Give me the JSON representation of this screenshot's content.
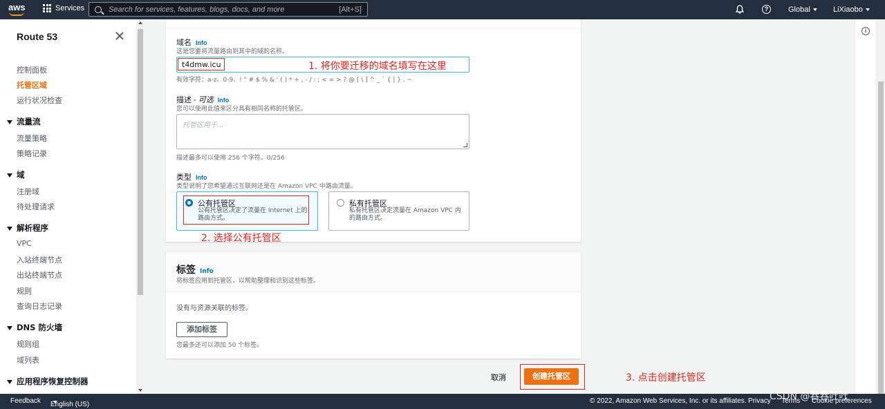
{
  "topnav": {
    "logo": "aws",
    "services": "Services",
    "search_placeholder": "Search for services, features, blogs, docs, and more",
    "search_shortcut": "[Alt+S]",
    "region": "Global",
    "user": "LiXiaobo"
  },
  "sidebar": {
    "title": "Route 53",
    "items_top": [
      "控制面板",
      "托管区域",
      "运行状况检查"
    ],
    "active_item": "托管区域",
    "groups": [
      {
        "label": "流量流",
        "items": [
          "流量策略",
          "策略记录"
        ]
      },
      {
        "label": "域",
        "items": [
          "注册域",
          "待处理请求"
        ]
      },
      {
        "label": "解析程序",
        "items": [
          "VPC",
          "入站终端节点",
          "出站终端节点",
          "规则",
          "查询日志记录"
        ]
      },
      {
        "label": "DNS 防火墙",
        "items": [
          "规则组",
          "域列表"
        ]
      },
      {
        "label": "应用程序恢复控制器",
        "items": []
      }
    ]
  },
  "form": {
    "domain_label": "域名",
    "domain_info": "Info",
    "domain_desc": "这是您要将流量路由到其中的域的名称。",
    "domain_value": "t4dmw.icu",
    "domain_hint": "有效字符：a-z、0-9、! \" # $ % & ' ( ) * + , - / : ; < = > ? @ [ \\ ] ^ _ ` { | } . ~",
    "desc_label": "描述 -",
    "desc_optional": "可选",
    "desc_info": "Info",
    "desc_desc": "您可以使用此值来区分具有相同名称的托管区。",
    "desc_placeholder": "托管区用于...",
    "desc_hint": "描述最多可以使用 256 个字符。0/256",
    "type_label": "类型",
    "type_info": "Info",
    "type_desc": "类型说明了您希望通过互联网还是在 Amazon VPC 中路由流量。",
    "public_title": "公有托管区",
    "public_desc_1": "公有托管区决定了流量在 Internet 上的",
    "public_desc_2": "路由方式。",
    "private_title": "私有托管区",
    "private_desc_1": "私有托管区决定流量在 Amazon VPC 内",
    "private_desc_2": "的路由方式。",
    "selected_type": "public"
  },
  "tags": {
    "title": "标签",
    "info": "Info",
    "desc": "将标签应用到托管区，以帮助整理和识别这些标签。",
    "empty": "没有与资源关联的标签。",
    "add_button": "添加标签",
    "limit": "您最多还可以添加 50 个标签。"
  },
  "actions": {
    "cancel": "取消",
    "create": "创建托管区"
  },
  "annotations": {
    "step1": "1. 将你要迁移的域名填写在这里",
    "step2": "2. 选择公有托管区",
    "step3": "3. 点击创建托管区"
  },
  "footer": {
    "feedback": "Feedback",
    "language": "English (US)",
    "copyright": "© 2022, Amazon Web Services, Inc. or its affiliates.",
    "privacy": "Privacy",
    "terms": "Terms",
    "cookie": "Cookie preferences"
  },
  "watermark": "CSDN @吞吞吐吐",
  "colors": {
    "nav_bg": "#232f3e",
    "accent": "#ec7211",
    "link": "#0073bb",
    "annotation": "#e0271f"
  }
}
